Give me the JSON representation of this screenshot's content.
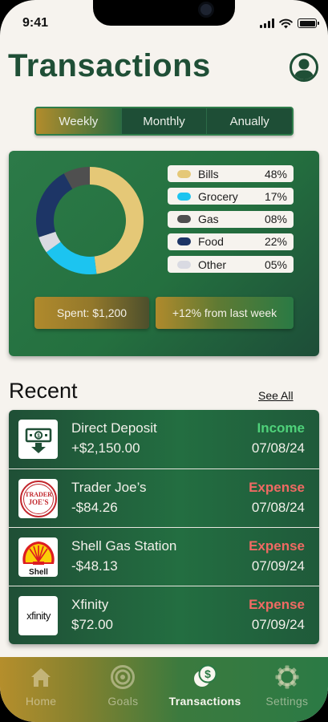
{
  "status_bar": {
    "time": "9:41"
  },
  "header": {
    "title": "Transactions"
  },
  "period_tabs": [
    {
      "label": "Weekly",
      "active": true
    },
    {
      "label": "Monthly",
      "active": false
    },
    {
      "label": "Anually",
      "active": false
    }
  ],
  "summary": {
    "legend": [
      {
        "label": "Bills",
        "pct": "48%",
        "color": "#e5c877"
      },
      {
        "label": "Grocery",
        "pct": "17%",
        "color": "#1cc4f0"
      },
      {
        "label": "Gas",
        "pct": "08%",
        "color": "#4f4f4f"
      },
      {
        "label": "Food",
        "pct": "22%",
        "color": "#1d3566"
      },
      {
        "label": "Other",
        "pct": "05%",
        "color": "#d9dae2"
      }
    ],
    "spent_label": "Spent: $1,200",
    "change_label": "+12% from last week"
  },
  "chart_data": {
    "type": "pie",
    "categories": [
      "Bills",
      "Grocery",
      "Other",
      "Food",
      "Gas"
    ],
    "values": [
      48,
      17,
      5,
      22,
      8
    ],
    "colors": [
      "#e5c877",
      "#1cc4f0",
      "#d9dae2",
      "#1d3566",
      "#4f4f4f"
    ],
    "donut": true
  },
  "recent": {
    "title": "Recent",
    "see_all": "See All",
    "transactions": [
      {
        "name": "Direct Deposit",
        "amount": "+$2,150.00",
        "type": "Income",
        "date": "07/08/24",
        "logo": "deposit-icon"
      },
      {
        "name": "Trader Joe’s",
        "amount": "-$84.26",
        "type": "Expense",
        "date": "07/08/24",
        "logo": "trader-joes-logo",
        "logo_text_1": "TRADER",
        "logo_text_2": "JOE'S"
      },
      {
        "name": "Shell Gas Station",
        "amount": "-$48.13",
        "type": "Expense",
        "date": "07/09/24",
        "logo": "shell-logo",
        "logo_text": "Shell"
      },
      {
        "name": "Xfinity",
        "amount": "$72.00",
        "type": "Expense",
        "date": "07/09/24",
        "logo": "xfinity-logo",
        "logo_text": "xfinity"
      }
    ]
  },
  "bottom_nav": [
    {
      "label": "Home",
      "icon": "home-icon",
      "active": false
    },
    {
      "label": "Goals",
      "icon": "target-icon",
      "active": false
    },
    {
      "label": "Transactions",
      "icon": "coins-icon",
      "active": true
    },
    {
      "label": "Settings",
      "icon": "gear-icon",
      "active": false
    }
  ],
  "colors": {
    "brand_green": "#1f4f36",
    "accent_gold": "#b28c2c",
    "income": "#4fd27a",
    "expense": "#f06a63",
    "background": "#f6f3ee"
  }
}
